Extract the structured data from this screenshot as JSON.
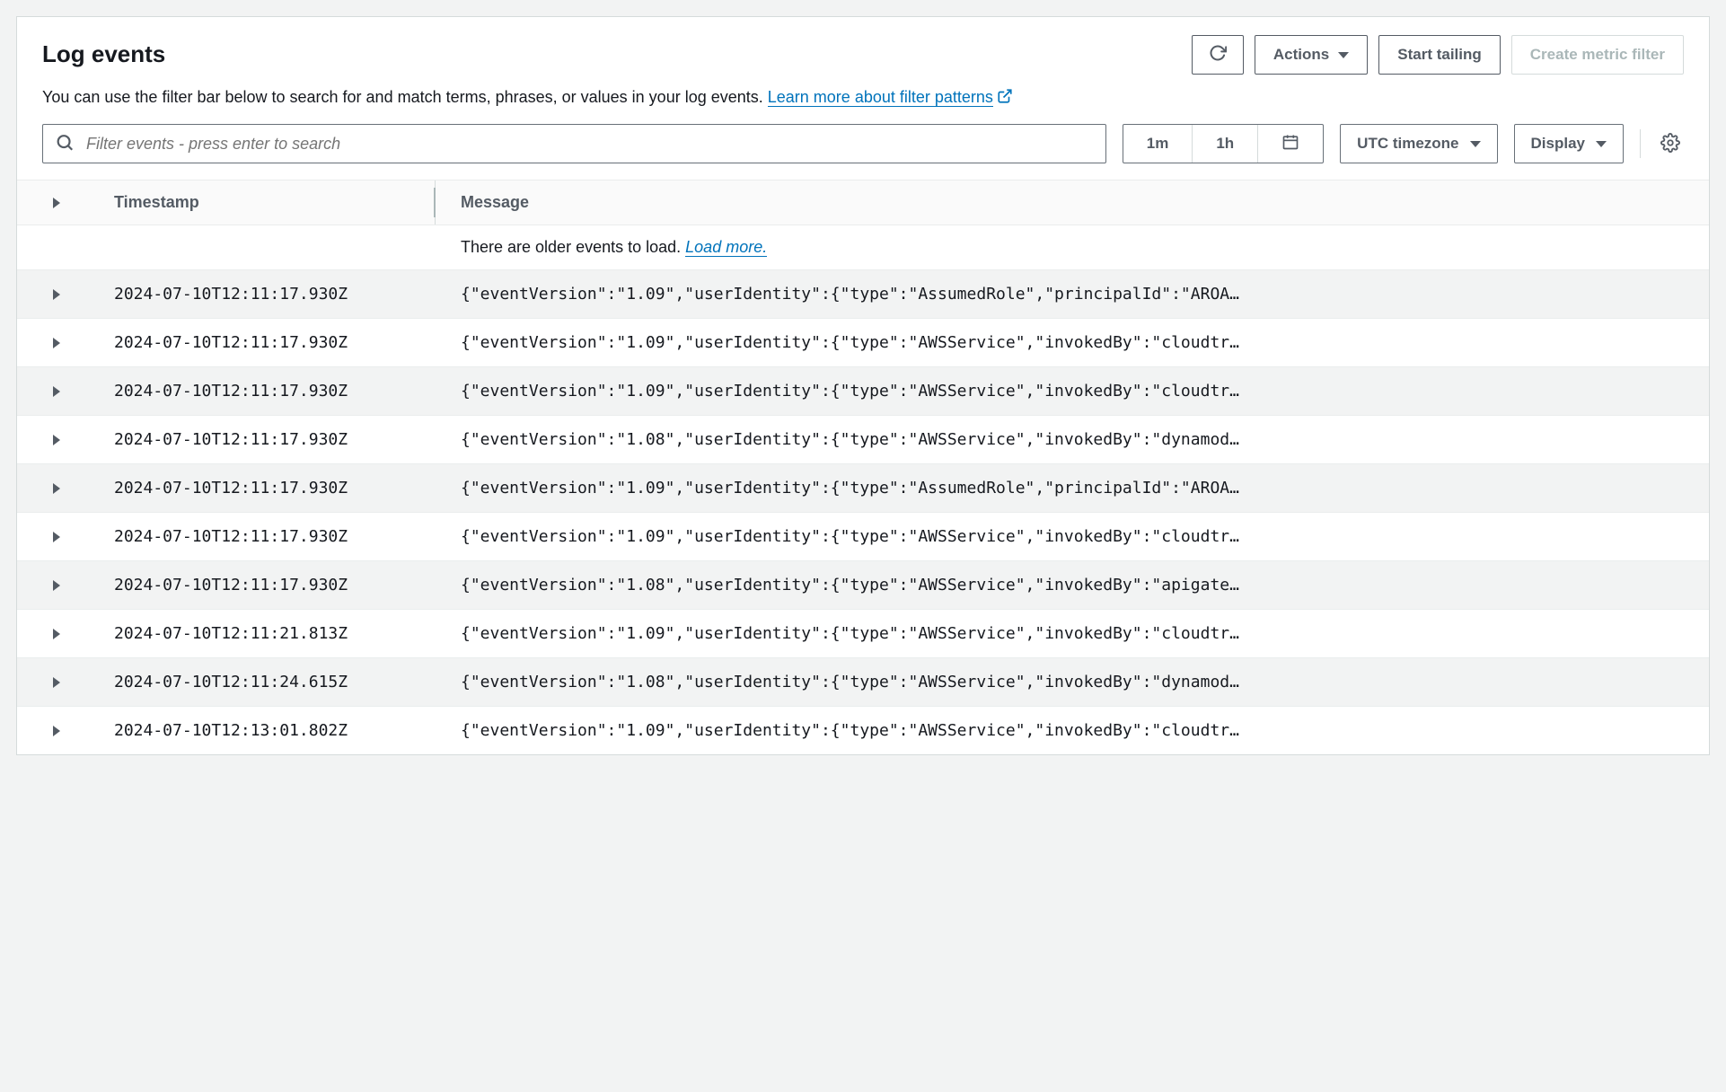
{
  "header": {
    "title": "Log events",
    "actions_label": "Actions",
    "start_tailing_label": "Start tailing",
    "create_filter_label": "Create metric filter",
    "subtext": "You can use the filter bar below to search for and match terms, phrases, or values in your log events. ",
    "learn_more": "Learn more about filter patterns"
  },
  "filter": {
    "placeholder": "Filter events - press enter to search",
    "range_1m": "1m",
    "range_1h": "1h",
    "timezone": "UTC timezone",
    "display_label": "Display"
  },
  "table": {
    "timestamp_header": "Timestamp",
    "message_header": "Message",
    "older_text": "There are older events to load. ",
    "load_more": "Load more.",
    "rows": [
      {
        "ts": "2024-07-10T12:11:17.930Z",
        "msg": "{\"eventVersion\":\"1.09\",\"userIdentity\":{\"type\":\"AssumedRole\",\"principalId\":\"AROA…"
      },
      {
        "ts": "2024-07-10T12:11:17.930Z",
        "msg": "{\"eventVersion\":\"1.09\",\"userIdentity\":{\"type\":\"AWSService\",\"invokedBy\":\"cloudtr…"
      },
      {
        "ts": "2024-07-10T12:11:17.930Z",
        "msg": "{\"eventVersion\":\"1.09\",\"userIdentity\":{\"type\":\"AWSService\",\"invokedBy\":\"cloudtr…"
      },
      {
        "ts": "2024-07-10T12:11:17.930Z",
        "msg": "{\"eventVersion\":\"1.08\",\"userIdentity\":{\"type\":\"AWSService\",\"invokedBy\":\"dynamod…"
      },
      {
        "ts": "2024-07-10T12:11:17.930Z",
        "msg": "{\"eventVersion\":\"1.09\",\"userIdentity\":{\"type\":\"AssumedRole\",\"principalId\":\"AROA…"
      },
      {
        "ts": "2024-07-10T12:11:17.930Z",
        "msg": "{\"eventVersion\":\"1.09\",\"userIdentity\":{\"type\":\"AWSService\",\"invokedBy\":\"cloudtr…"
      },
      {
        "ts": "2024-07-10T12:11:17.930Z",
        "msg": "{\"eventVersion\":\"1.08\",\"userIdentity\":{\"type\":\"AWSService\",\"invokedBy\":\"apigate…"
      },
      {
        "ts": "2024-07-10T12:11:21.813Z",
        "msg": "{\"eventVersion\":\"1.09\",\"userIdentity\":{\"type\":\"AWSService\",\"invokedBy\":\"cloudtr…"
      },
      {
        "ts": "2024-07-10T12:11:24.615Z",
        "msg": "{\"eventVersion\":\"1.08\",\"userIdentity\":{\"type\":\"AWSService\",\"invokedBy\":\"dynamod…"
      },
      {
        "ts": "2024-07-10T12:13:01.802Z",
        "msg": "{\"eventVersion\":\"1.09\",\"userIdentity\":{\"type\":\"AWSService\",\"invokedBy\":\"cloudtr…"
      }
    ]
  }
}
